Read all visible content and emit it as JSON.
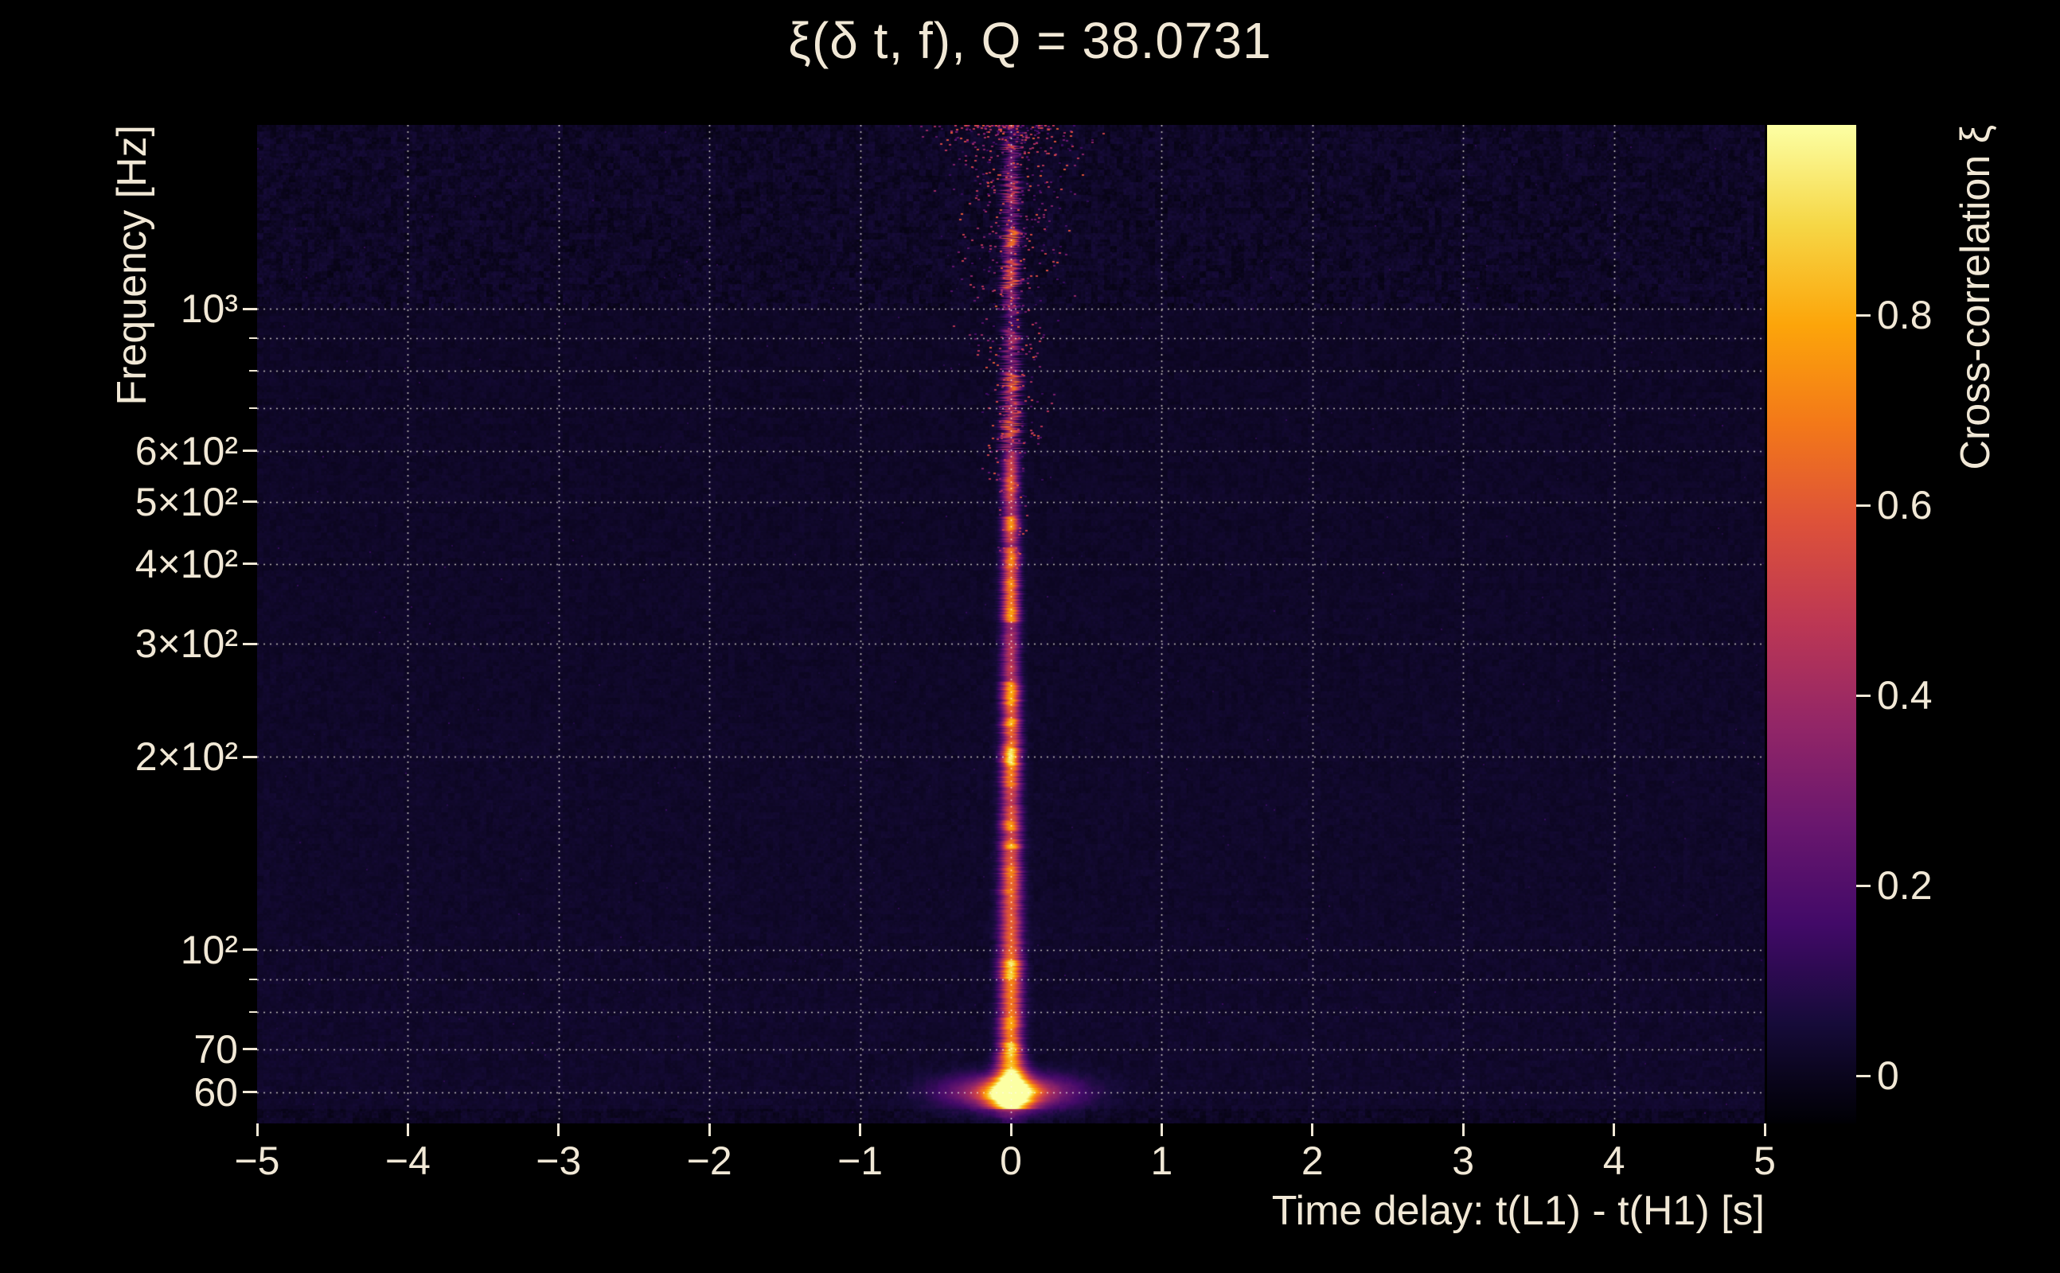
{
  "title": "ξ(δ t, f), Q = 38.0731",
  "colors": {
    "page_bg": "#000000",
    "text": "#f1e8d6",
    "grid": "rgba(255,250,238,0.75)",
    "heatmap_background": "#160b39",
    "ridge_peak": "#fcffa4"
  },
  "axes": {
    "x": {
      "label": "Time delay: t(L1) - t(H1) [s]",
      "min": -5,
      "max": 5,
      "ticks": [
        {
          "v": -5,
          "label": "−5"
        },
        {
          "v": -4,
          "label": "−4"
        },
        {
          "v": -3,
          "label": "−3"
        },
        {
          "v": -2,
          "label": "−2"
        },
        {
          "v": -1,
          "label": "−1"
        },
        {
          "v": 0,
          "label": "0"
        },
        {
          "v": 1,
          "label": "1"
        },
        {
          "v": 2,
          "label": "2"
        },
        {
          "v": 3,
          "label": "3"
        },
        {
          "v": 4,
          "label": "4"
        },
        {
          "v": 5,
          "label": "5"
        }
      ]
    },
    "y": {
      "label": "Frequency [Hz]",
      "scale": "log",
      "min_hz": 53.6,
      "max_hz": 1936,
      "major_ticks": [
        {
          "v": 1000,
          "label": "10³"
        },
        {
          "v": 600,
          "label": "6×10²"
        },
        {
          "v": 500,
          "label": "5×10²"
        },
        {
          "v": 400,
          "label": "4×10²"
        },
        {
          "v": 300,
          "label": "3×10²"
        },
        {
          "v": 200,
          "label": "2×10²"
        },
        {
          "v": 100,
          "label": "10²"
        },
        {
          "v": 70,
          "label": "70"
        },
        {
          "v": 60,
          "label": "60"
        }
      ],
      "minor_ticks": [
        900,
        800,
        700,
        90,
        80
      ]
    },
    "colorbar": {
      "label": "Cross-correlation ξ",
      "min": -0.05,
      "max": 1.0,
      "ticks": [
        {
          "v": 0.8,
          "label": "0.8"
        },
        {
          "v": 0.6,
          "label": "0.6"
        },
        {
          "v": 0.4,
          "label": "0.4"
        },
        {
          "v": 0.2,
          "label": "0.2"
        },
        {
          "v": 0,
          "label": "0"
        }
      ]
    }
  },
  "chart_data": {
    "type": "heatmap",
    "title": "ξ(δ t, f), Q = 38.0731",
    "q_value": 38.0731,
    "xlabel": "Time delay: t(L1) - t(H1) [s]",
    "ylabel": "Frequency [Hz]",
    "colorbar_label": "Cross-correlation ξ",
    "xlim": [
      -5,
      5
    ],
    "ylim_hz": [
      53.6,
      1936
    ],
    "y_scale": "log",
    "grid": "dotted, horizontal at every decade subtick and vertical at every integer second",
    "colormap": "inferno",
    "color_range": [
      -0.05,
      1.0
    ],
    "colormap_stops": [
      [
        0.0,
        "#000004"
      ],
      [
        0.1,
        "#160b39"
      ],
      [
        0.2,
        "#420a68"
      ],
      [
        0.3,
        "#6a176e"
      ],
      [
        0.4,
        "#932667"
      ],
      [
        0.5,
        "#bc3754"
      ],
      [
        0.6,
        "#dd513a"
      ],
      [
        0.7,
        "#f37819"
      ],
      [
        0.8,
        "#fca50a"
      ],
      [
        0.9,
        "#f6d746"
      ],
      [
        1.0,
        "#fcffa4"
      ]
    ],
    "description": "Cross-correlation ξ between LIGO L1 and H1 strain versus time delay and frequency. Background is near ξ≈0 (dark purple). A bright narrow ridge of high correlation runs along zero time delay at all frequencies, blobby with frequency, brightest (ξ≈1, white) below ~130 Hz and widest around 60 Hz where a broad halo extends to |δt|≈0.5 s. A dark low-ξ band lies below ~56 Hz, and speckled noise surrounds the ridge at high frequency.",
    "background_xi": 0.02,
    "ridge": {
      "center_delay_s": 0,
      "amplitude_vs_freq": [
        [
          54,
          0.5
        ],
        [
          58,
          0.95
        ],
        [
          60,
          1.0
        ],
        [
          64,
          0.85
        ],
        [
          72,
          0.95
        ],
        [
          80,
          0.9
        ],
        [
          90,
          0.95
        ],
        [
          100,
          0.85
        ],
        [
          115,
          0.8
        ],
        [
          130,
          0.9
        ],
        [
          150,
          0.8
        ],
        [
          170,
          0.72
        ],
        [
          200,
          0.82
        ],
        [
          230,
          0.7
        ],
        [
          260,
          0.74
        ],
        [
          300,
          0.7
        ],
        [
          340,
          0.74
        ],
        [
          400,
          0.66
        ],
        [
          460,
          0.74
        ],
        [
          520,
          0.7
        ],
        [
          600,
          0.64
        ],
        [
          700,
          0.66
        ],
        [
          800,
          0.62
        ],
        [
          900,
          0.64
        ],
        [
          1000,
          0.58
        ],
        [
          1200,
          0.56
        ],
        [
          1400,
          0.52
        ],
        [
          1600,
          0.48
        ],
        [
          1800,
          0.44
        ],
        [
          1936,
          0.42
        ]
      ],
      "sigma_s_vs_freq": [
        [
          54,
          0.07
        ],
        [
          58,
          0.1
        ],
        [
          60,
          0.11
        ],
        [
          64,
          0.07
        ],
        [
          70,
          0.05
        ],
        [
          100,
          0.05
        ],
        [
          200,
          0.042
        ],
        [
          400,
          0.038
        ],
        [
          800,
          0.032
        ],
        [
          1936,
          0.028
        ]
      ],
      "halo_60hz": {
        "freq_hz": 60,
        "freq_sigma_hz": 2.5,
        "sigma_s": 0.28,
        "amplitude": 0.55
      }
    },
    "noise": {
      "base_amp": 0.017,
      "high_freq_amp": 0.034,
      "high_freq_above_hz": 1000,
      "bottom_band_below_hz": 56.5,
      "bottom_band_base_xi": 0.004,
      "row_band_amp": 0.01
    },
    "speckle": {
      "top_count": 800,
      "top_y_frac": 0.45,
      "faint_count": 400
    }
  }
}
